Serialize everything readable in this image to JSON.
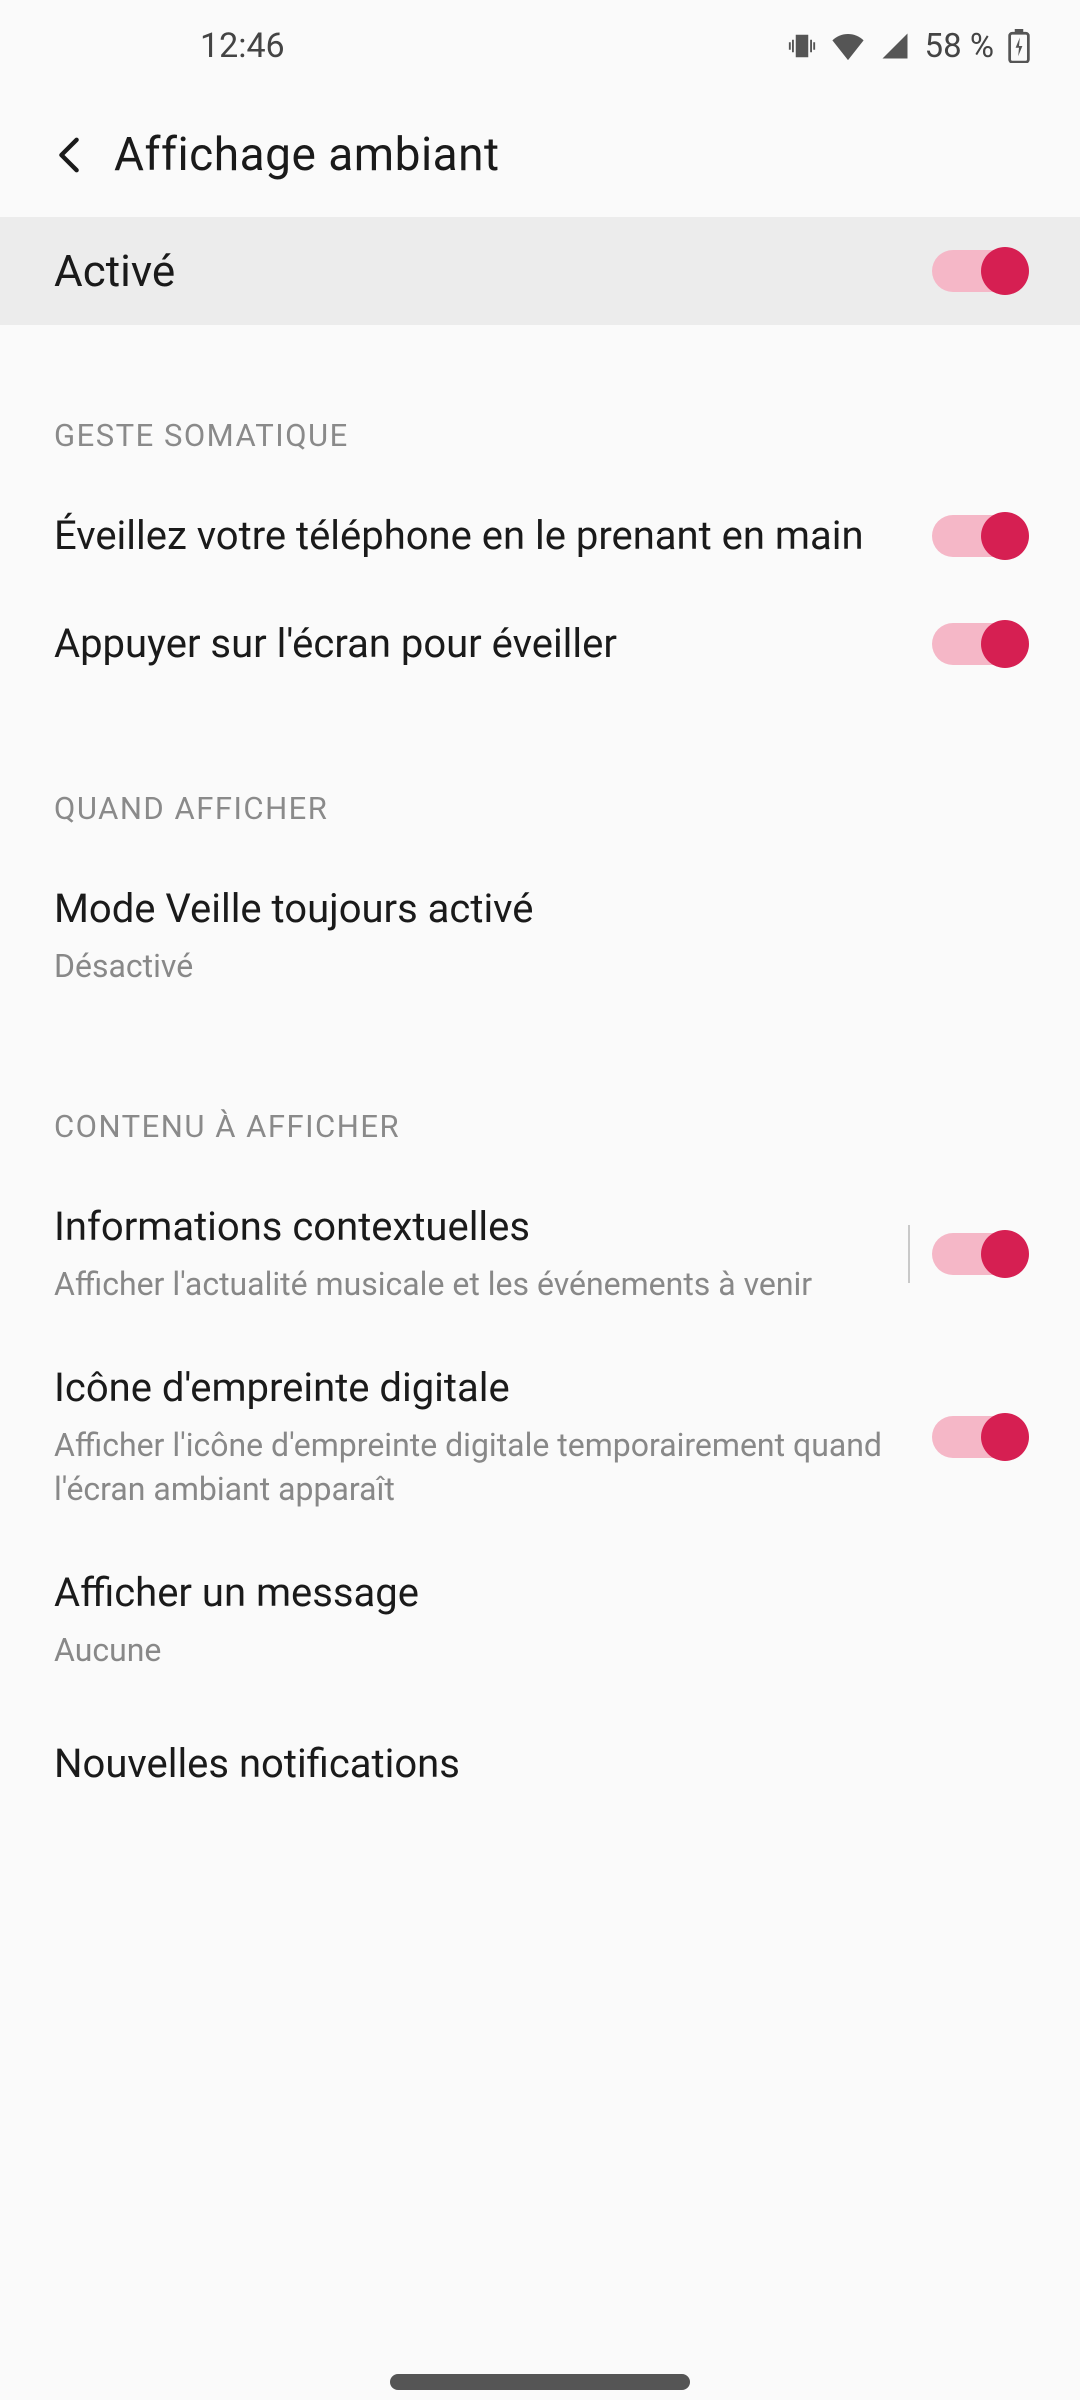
{
  "status": {
    "time": "12:46",
    "battery": "58 %"
  },
  "header": {
    "title": "Affichage ambiant"
  },
  "master": {
    "label": "Activé",
    "on": true
  },
  "section_gesture": {
    "header": "GESTE SOMATIQUE",
    "wake_pickup": {
      "title": "Éveillez votre téléphone en le prenant en main",
      "on": true
    },
    "tap_wake": {
      "title": "Appuyer sur l'écran pour éveiller",
      "on": true
    }
  },
  "section_when": {
    "header": "QUAND AFFICHER",
    "always_on": {
      "title": "Mode Veille toujours activé",
      "status": "Désactivé"
    }
  },
  "section_content": {
    "header": "CONTENU À AFFICHER",
    "contextual": {
      "title": "Informations contextuelles",
      "subtitle": "Afficher l'actualité musicale et les événements à venir",
      "on": true
    },
    "fingerprint": {
      "title": "Icône d'empreinte digitale",
      "subtitle": "Afficher l'icône d'empreinte digitale temporairement quand l'écran ambiant apparaît",
      "on": true
    },
    "message": {
      "title": "Afficher un message",
      "status": "Aucune"
    },
    "notifications": {
      "title": "Nouvelles notifications"
    }
  }
}
